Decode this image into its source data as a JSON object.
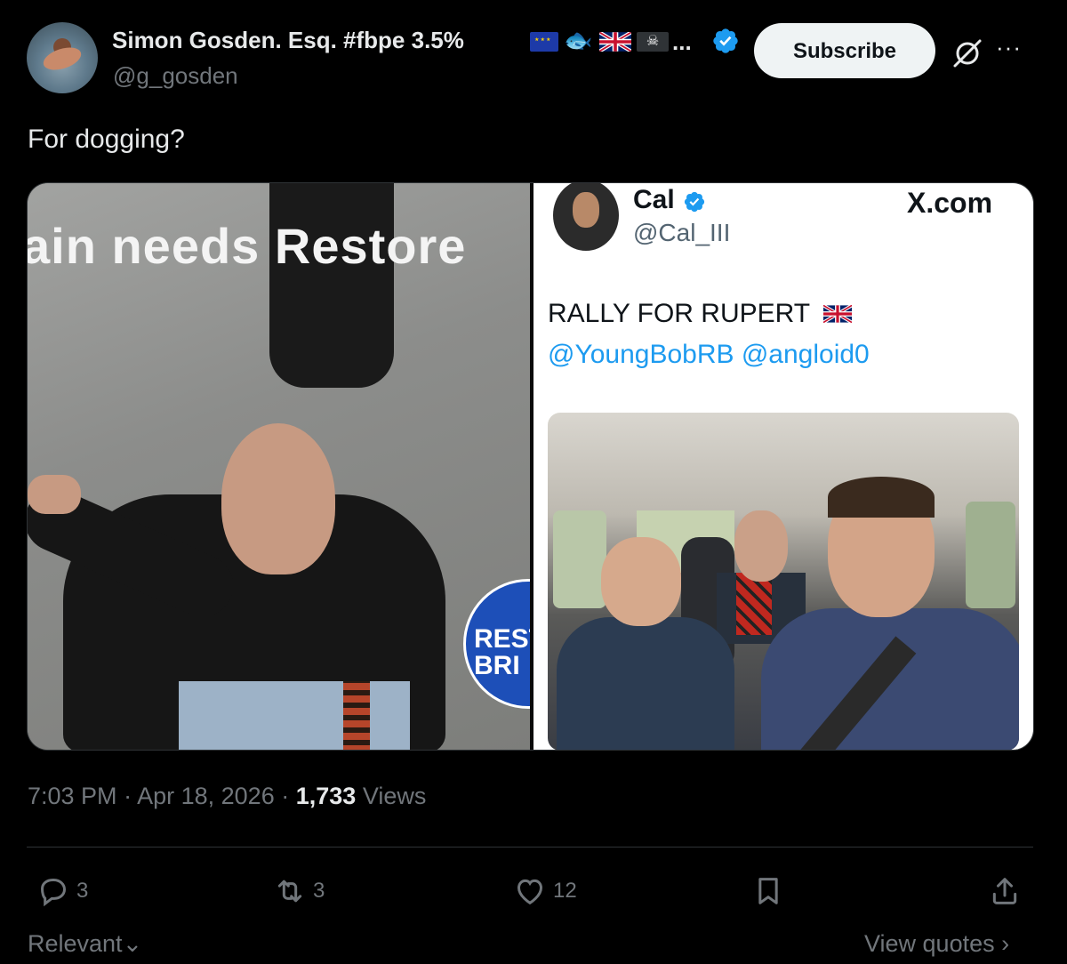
{
  "author": {
    "display_name": "Simon Gosden. Esq. #fbpe 3.5%",
    "name_overflow": "...",
    "handle": "@g_gosden",
    "verified": true,
    "avatar_icon": "avatar-photo"
  },
  "header": {
    "subscribe_label": "Subscribe",
    "grok_icon": "grok-icon",
    "more_icon": "more-dots-icon",
    "more_label": "···"
  },
  "tweet": {
    "text": "For dogging?"
  },
  "media": {
    "left": {
      "banner_text": "ain needs Restore",
      "logo_text": "REST\nBRI"
    },
    "right": {
      "name": "Cal",
      "handle": "@Cal_III",
      "site": "X.com",
      "text": "RALLY FOR RUPERT",
      "mentions": "@YoungBobRB @angloid0"
    }
  },
  "meta": {
    "time": "7:03 PM",
    "date": "Apr 18, 2026",
    "views_count": "1,733",
    "views_label": "Views"
  },
  "actions": {
    "replies": "3",
    "reposts": "3",
    "likes": "12"
  },
  "footer": {
    "sort_label": "Relevant",
    "quotes_label": "View quotes"
  },
  "colors": {
    "background": "#000000",
    "text": "#e7e9ea",
    "secondary": "#71767b",
    "verified": "#1d9bf0",
    "link": "#1d9bf0"
  }
}
